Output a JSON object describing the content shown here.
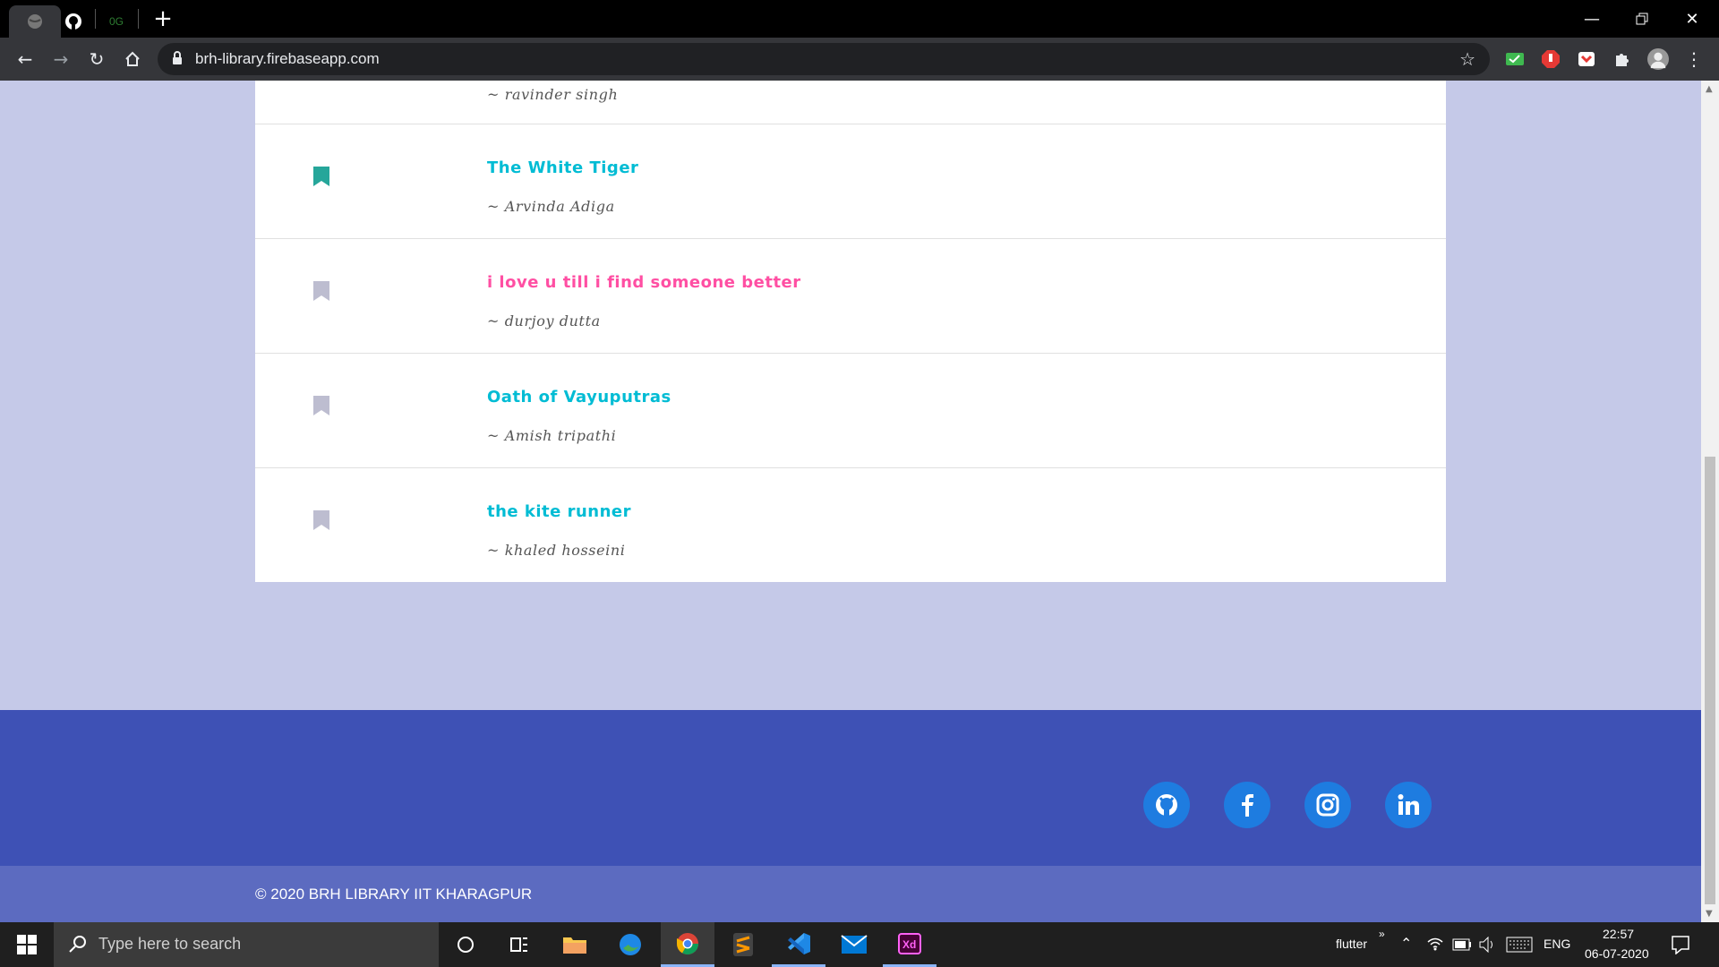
{
  "browser": {
    "url": "brh-library.firebaseapp.com",
    "tab_label_2": "0G"
  },
  "books": [
    {
      "title": "",
      "author": "~ ravinder singh",
      "bookmarked": false,
      "color": "#00bcd4"
    },
    {
      "title": "The White Tiger",
      "author": "~ Arvinda Adiga",
      "bookmarked": true,
      "color": "#00bcd4"
    },
    {
      "title": "i love u till i find someone better",
      "author": "~ durjoy dutta",
      "bookmarked": false,
      "color": "#ff4fa3"
    },
    {
      "title": "Oath of Vayuputras",
      "author": "~ Amish tripathi",
      "bookmarked": false,
      "color": "#00bcd4"
    },
    {
      "title": "the kite runner",
      "author": "~ khaled hosseini",
      "bookmarked": false,
      "color": "#00bcd4"
    }
  ],
  "footer": {
    "social": [
      "github-icon",
      "facebook-icon",
      "instagram-icon",
      "linkedin-icon"
    ],
    "copyright": "© 2020 BRH LIBRARY IIT KHARAGPUR"
  },
  "taskbar": {
    "search_placeholder": "Type here to search",
    "tray_app": "flutter",
    "language": "ENG",
    "time": "22:57",
    "date": "06-07-2020"
  },
  "colors": {
    "bookmark_active": "#26a69a",
    "bookmark_inactive": "#bdbdd0",
    "footer": "#3e51b5",
    "copyright_bar": "#5c6bc0",
    "social_circle": "#1e7ce0"
  }
}
